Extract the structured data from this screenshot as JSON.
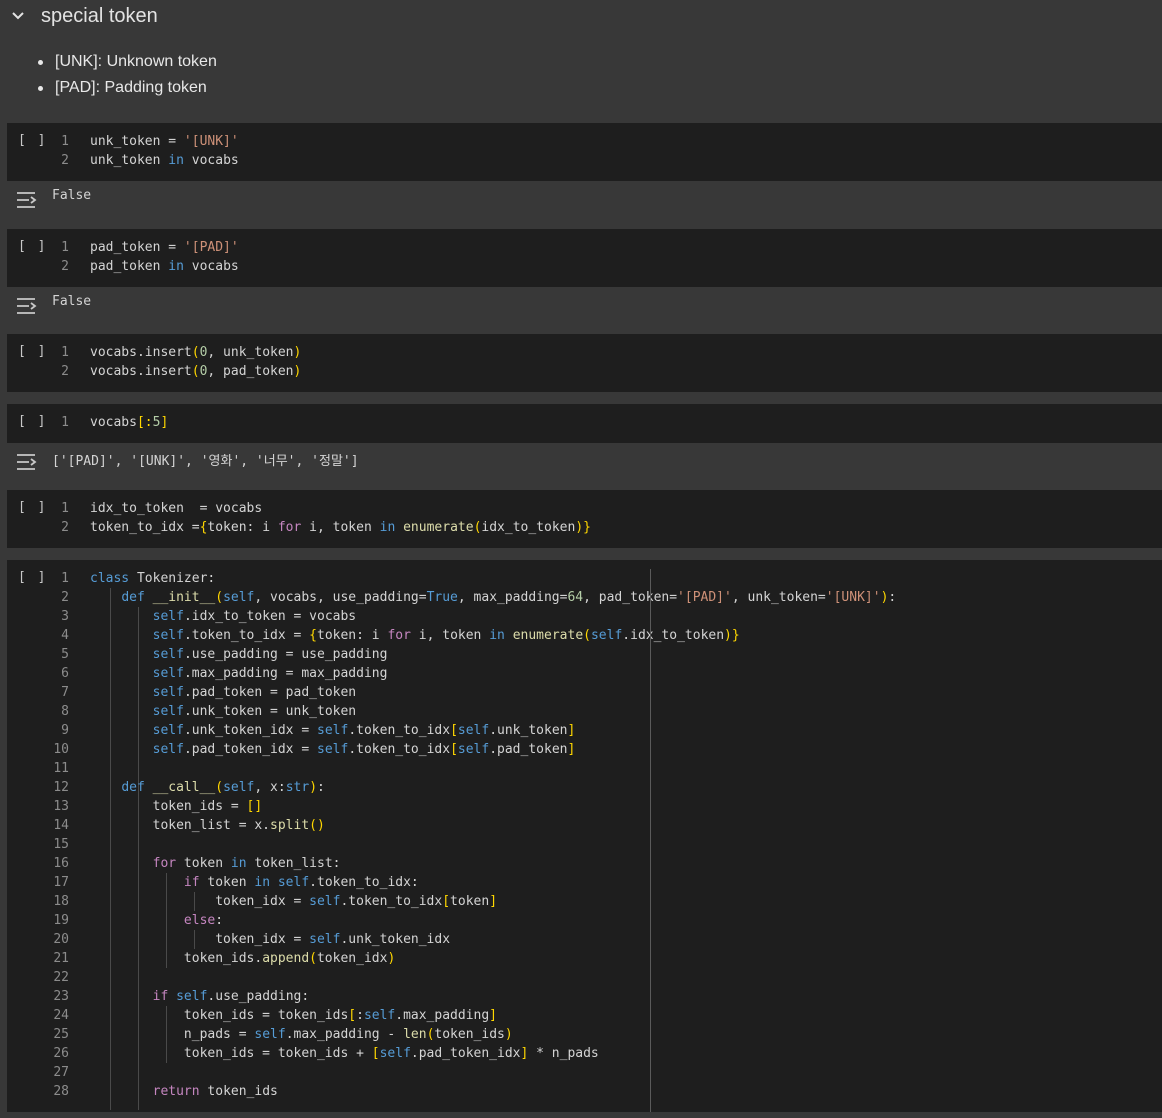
{
  "section": {
    "title": "special token"
  },
  "bullets": [
    "[UNK]: Unknown token",
    "[PAD]: Padding token"
  ],
  "run_label": "[ ]",
  "cells": [
    {
      "lines": [
        "1",
        "2"
      ],
      "output": "False"
    },
    {
      "lines": [
        "1",
        "2"
      ],
      "output": "False"
    },
    {
      "lines": [
        "1",
        "2"
      ]
    },
    {
      "lines": [
        "1"
      ],
      "output": "['[PAD]', '[UNK]', '영화', '너무', '정말']"
    },
    {
      "lines": [
        "1",
        "2"
      ]
    },
    {
      "lines": [
        "1",
        "2",
        "3",
        "4",
        "5",
        "6",
        "7",
        "8",
        "9",
        "10",
        "11",
        "12",
        "13",
        "14",
        "15",
        "16",
        "17",
        "18",
        "19",
        "20",
        "21",
        "22",
        "23",
        "24",
        "25",
        "26",
        "27",
        "28"
      ]
    }
  ],
  "code": {
    "c1": {
      "l1a": "unk_token = ",
      "l1b": "'[UNK]'",
      "l2a": "unk_token ",
      "l2b": "in",
      "l2c": " vocabs"
    },
    "c2": {
      "l1a": "pad_token = ",
      "l1b": "'[PAD]'",
      "l2a": "pad_token ",
      "l2b": "in",
      "l2c": " vocabs"
    },
    "c3": {
      "l1a": "vocabs.insert",
      "l1b": "(",
      "l1c": "0",
      "l1d": ", unk_token",
      "l1e": ")",
      "l2a": "vocabs.insert",
      "l2b": "(",
      "l2c": "0",
      "l2d": ", pad_token",
      "l2e": ")"
    },
    "c4": {
      "l1a": "vocabs",
      "l1b": "[:",
      "l1c": "5",
      "l1d": "]"
    },
    "c5": {
      "l1": "idx_to_token  = vocabs",
      "l2a": "token_to_idx =",
      "l2b": "{",
      "l2c": "token: i ",
      "l2d": "for",
      "l2e": " i, token ",
      "l2f": "in",
      "l2g": " enumerate",
      "l2h": "(",
      "l2i": "idx_to_token",
      "l2j": ")",
      "l2k": "}"
    }
  },
  "tokenizer": {
    "class_kw": "class",
    "class_name": " Tokenizer:",
    "def": "def",
    "init": " __init__",
    "call": " __call__",
    "self": "self",
    "true": "True",
    "num64": "64",
    "pad_str": "'[PAD]'",
    "unk_str": "'[UNK]'",
    "for": "for",
    "in": "in",
    "if": "if",
    "else": "else",
    "return": "return",
    "enumerate": "enumerate",
    "split": "split",
    "append": "append",
    "len": "len",
    "str": "str"
  }
}
